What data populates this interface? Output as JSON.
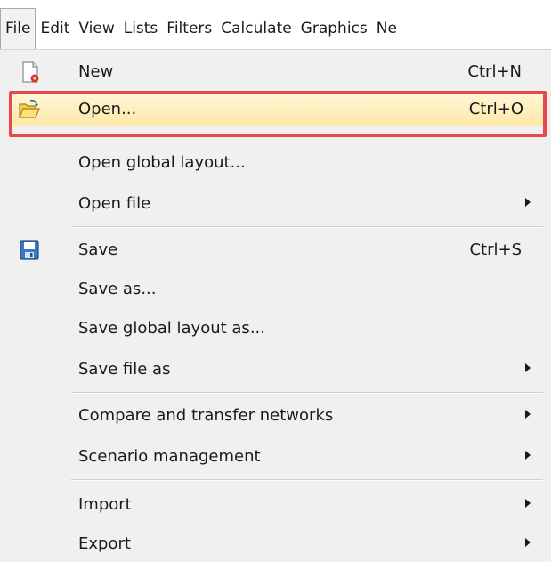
{
  "menubar": {
    "items": [
      "File",
      "Edit",
      "View",
      "Lists",
      "Filters",
      "Calculate",
      "Graphics",
      "Ne"
    ]
  },
  "menu": {
    "new": {
      "label": "New",
      "shortcut": "Ctrl+N",
      "icon": "new-file-icon"
    },
    "open": {
      "label": "Open...",
      "shortcut": "Ctrl+O",
      "icon": "open-folder-icon"
    },
    "open_global_layout": {
      "label": "Open global layout..."
    },
    "open_file": {
      "label": "Open file"
    },
    "save": {
      "label": "Save",
      "shortcut": "Ctrl+S",
      "icon": "floppy-disk-icon"
    },
    "save_as": {
      "label": "Save as..."
    },
    "save_global_layout_as": {
      "label": "Save global layout as..."
    },
    "save_file_as": {
      "label": "Save file as"
    },
    "compare_transfer": {
      "label": "Compare and transfer networks"
    },
    "scenario_management": {
      "label": "Scenario management"
    },
    "import": {
      "label": "Import"
    },
    "export": {
      "label": "Export"
    }
  },
  "colors": {
    "highlight_frame": "#e8484c",
    "hover_fill": "#fde9a8",
    "menu_bg": "#f0f0f0"
  }
}
